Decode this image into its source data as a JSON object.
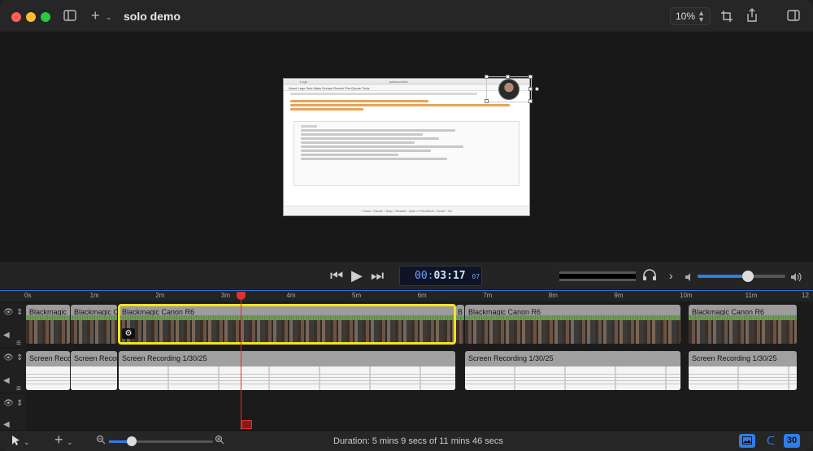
{
  "window": {
    "title": "solo demo"
  },
  "toolbar": {
    "zoom": "10%"
  },
  "viewer": {
    "frame_title": "Logs",
    "frame_subtitle": "parlsson.test",
    "tabs": "About  Logs  Solo  Make  Dumps  Reverb  Pint  Queue  Tools",
    "footer": "‹ Clear   ‹ Pause   ‹ Stop   ‹ Restart   ‹ Quit   ‹/› Prev/Next   ‹ Scroll   ‹ Go"
  },
  "transport": {
    "timecode_pre": "00:",
    "timecode_main": "03:17",
    "timecode_frames": "07",
    "volume_fraction": 0.57
  },
  "ruler": {
    "ticks": [
      "0s",
      "1m",
      "2m",
      "3m",
      "4m",
      "5m",
      "6m",
      "7m",
      "8m",
      "9m",
      "10m",
      "11m",
      "12"
    ]
  },
  "tracks": {
    "camera": [
      {
        "label": "Blackmagic"
      },
      {
        "label": "Blackmagic C"
      },
      {
        "label": "Blackmagic Canon R6"
      },
      {
        "label": "B"
      },
      {
        "label": "Blackmagic Canon R6"
      },
      {
        "label": "Blackmagic Canon R6"
      }
    ],
    "screen": [
      {
        "label": "Screen Recc"
      },
      {
        "label": "Screen Recor"
      },
      {
        "label": "Screen Recording 1/30/25"
      },
      {
        "label": "Screen Recording 1/30/25"
      },
      {
        "label": "Screen Recording 1/30/25"
      }
    ]
  },
  "status": {
    "duration": "Duration: 5 mins 9 secs of 11 mins 46 secs"
  },
  "bottom": {
    "snap_label": "30"
  },
  "icons": {
    "sidebar": "sidebar-icon",
    "add": "plus-icon",
    "crop": "crop-icon",
    "share": "share-icon",
    "inspector": "inspector-icon",
    "prev": "skip-back-icon",
    "play": "play-icon",
    "next": "skip-forward-icon",
    "headphones": "headphones-icon",
    "volume": "volume-icon",
    "eye": "eye-icon",
    "speaker": "speaker-icon",
    "pointer": "pointer-icon",
    "gear": "gear-icon"
  },
  "colors": {
    "accent": "#2f7de9",
    "selection": "#f2e21f",
    "playhead": "#e03030",
    "timecode": "#6aa3ff"
  }
}
